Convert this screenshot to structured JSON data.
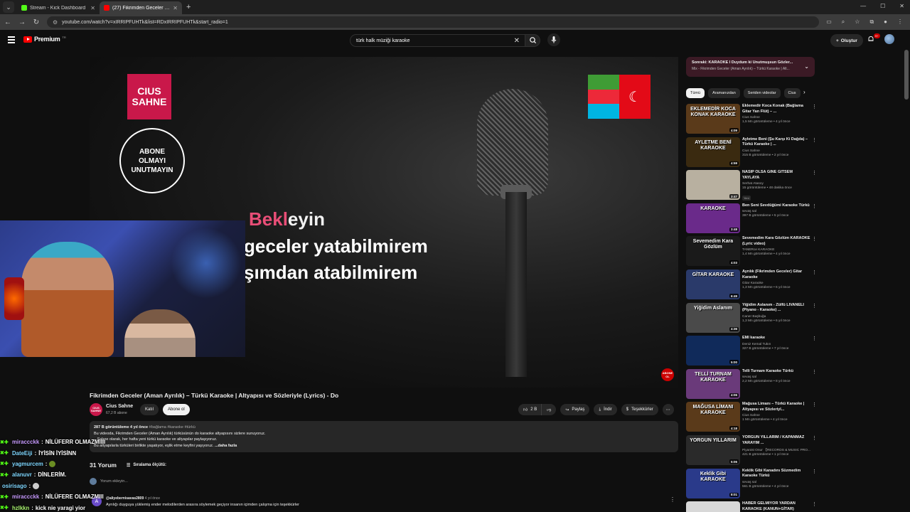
{
  "browser": {
    "tabs": [
      {
        "title": "Stream - Kick Dashboard",
        "active": false,
        "favicon_color": "#53fc18"
      },
      {
        "title": "(27) Fikrimden Geceler (Am...",
        "active": true,
        "favicon_color": "#ff0000"
      }
    ],
    "url": "youtube.com/watch?v=xIRRIPFUHTk&list=RDxIRRIPFUHTk&start_radio=1"
  },
  "youtube": {
    "logo_text": "Premium",
    "logo_sup": "TR",
    "search_query": "türk halk müziği karaoke",
    "create_label": "Oluştur",
    "notif_count": "9+"
  },
  "video": {
    "channel_logo_text": "CIUS SAHNE",
    "subscribe_circle_text": "ABONE OLMAYI UNUTMAYIN",
    "lyric_line1_highlight": "Bekl",
    "lyric_line1_rest": "eyin",
    "lyric_line2": "geceler yatabilmirem",
    "lyric_line3": "şımdan atabilmirem",
    "corner_badge": "ABONE OL",
    "title": "Fikrimden Geceler (Aman Ayrılık) – Türkü Karaoke | Altyapısı ve Sözleriyle (Lyrics) - Do",
    "channel_name": "Cius Sahne",
    "channel_subs": "67,2 B abone",
    "join_label": "Katıl",
    "subscribe_label": "Abone ol",
    "likes": "2 B",
    "share_label": "Paylaş",
    "download_label": "İndir",
    "thanks_label": "Teşekkürler",
    "desc_meta": "287 B görüntüleme  4 yıl önce",
    "desc_tags": "#bağlama #karaoke #türkü",
    "desc_line1": "Bu videoda, Fikrimden Geceler (Aman Ayrılık) türküsünün do karaoke altyapısını sizlere sunuyoruz.",
    "desc_line2": "...Sahne olarak, her hafta yeni türkü karaoke ve altyapılar paylaşıyoruz.",
    "desc_line3": "Bu altyapılarla türküleri birlikte yaşatıyor, eşlik etme keyfini yaşıyoruz. ",
    "desc_more": "...daha fazla"
  },
  "comments": {
    "count_label": "31 Yorum",
    "sort_label": "Sıralama ölçütü:",
    "add_placeholder": "Yorum ekleyin...",
    "first": {
      "avatar_letter": "A",
      "author": "@aliyebernisavas2809",
      "time": "4 yıl önce",
      "text": "Ayrılığı duyguya yüklemiş ender melodilerden arasıra söylemek geçiyor insanın içimden çalışma için teşekkürler"
    }
  },
  "chat": [
    {
      "nick": "miraccckk",
      "msg": "NİLÜFERR OLMAZMIIII"
    },
    {
      "nick": "DateEiji",
      "msg": "İYİSİN İYİSİNN"
    },
    {
      "nick": "yagmurcem",
      "msg": ""
    },
    {
      "nick": "alanuvr",
      "msg": "DİNLERİM."
    },
    {
      "nick": "osirisago",
      "msg": ""
    },
    {
      "nick": "miraccckk",
      "msg": "NİLÜFERE OLMAZMIII"
    },
    {
      "nick": "hzlkkn",
      "msg": "kick nie yaragi yior"
    }
  ],
  "sidebar": {
    "next_title": "Sonraki: KARAOKE I Duydum ki Unutmuşsun Gözler...",
    "next_sub": "Mix - Fikrimden Geceler (Aman Ayrılık) – Türkü Karaoke | Alt...",
    "chips": [
      "Tümü",
      "Aramanızdan",
      "Seriden videolar",
      "Cius"
    ],
    "items": [
      {
        "thumb": "EKLEMEDİR KOCA KONAK KARAOKE",
        "thumb_bg": "#5a3a1a",
        "dur": "4:09",
        "title": "Eklemedir Koca Konak (Bağlama Gitar Yan Flüt) – ...",
        "channel": "Cius Sahne",
        "views": "1,5 Mn görüntüleme • 4 yıl önce"
      },
      {
        "thumb": "AYLETME BENİ KARAOKE",
        "thumb_bg": "#3a2a10",
        "dur": "4:59",
        "title": "Ayletme Beni (Şu Karşı Ki Dağda) – Türkü Karaoke | ...",
        "channel": "Cius Sahne",
        "views": "315 B görüntüleme • 2 yıl önce"
      },
      {
        "thumb": "",
        "thumb_bg": "#b8b0a0",
        "dur": "3:47",
        "title": "NASİP OLSA GİNE GİTSEM YAYLAYA",
        "channel": "Serhat Atasoy",
        "views": "15 görüntüleme • 48 dakika önce",
        "tag": "Yeni"
      },
      {
        "thumb": "KARAOKE",
        "thumb_bg": "#6a2a8a",
        "dur": "3:48",
        "title": "Ben Seni Sevdüğümi Karaoke Türkü",
        "channel": "sevaş sal",
        "views": "397 B görüntüleme • 5 yıl önce"
      },
      {
        "thumb": "Sevemedim Kara Gözlüm",
        "thumb_bg": "#1a1a1a",
        "dur": "4:03",
        "title": "Sevemedim Kara Gözlüm KARAOKE (Lyric video)",
        "channel": "TANERce KARAOKE",
        "views": "1,4 Mn görüntüleme • 4 yıl önce"
      },
      {
        "thumb": "GİTAR KARAOKE",
        "thumb_bg": "#2a3a6a",
        "dur": "6:49",
        "title": "Ayrılık (Fikrimden Geceler) Gitar Karaoke",
        "channel": "Gitar Karaoke",
        "views": "1,3 Mn görüntüleme • 6 yıl önce"
      },
      {
        "thumb": "Yiğidim Aslanım",
        "thumb_bg": "#4a4a4a",
        "dur": "4:36",
        "title": "Yiğidim Aslanım - Zülfü LİVANELİ (Piyano - Karaoke) ...",
        "channel": "Caner Başbuğa",
        "views": "1,3 Mn görüntüleme • 6 yıl önce"
      },
      {
        "thumb": "",
        "thumb_bg": "#102a5a",
        "dur": "5:00",
        "title": "EMİ karaoke",
        "channel": "Deniz Kemal Tukın",
        "views": "327 B görüntüleme • 7 yıl önce"
      },
      {
        "thumb": "TELLİ TURNAM KARAOKE",
        "thumb_bg": "#6a3a7a",
        "dur": "4:06",
        "title": "Telli Turnam Karaoke Türkü",
        "channel": "sevaş sal",
        "views": "2,2 Mn görüntüleme • 8 yıl önce"
      },
      {
        "thumb": "MAĞUSA LİMANI KARAOKE",
        "thumb_bg": "#5a3a1a",
        "dur": "4:18",
        "title": "Mağusa Limanı – Türkü Karaoke | Altyapısı ve Sözleriyl...",
        "channel": "Cius Sahne",
        "views": "1 Mn görüntüleme • 4 yıl önce"
      },
      {
        "thumb": "YORGUN YILLARIM",
        "thumb_bg": "#2a2a2a",
        "dur": "5:06",
        "title": "YORGUN YILLARIM / KAPANMAZ YARAYIM ...",
        "channel": "Piyanist Onur 【RECORDS & MUSIC PRO...",
        "views": "421 B görüntüleme • 1 yıl önce"
      },
      {
        "thumb": "Keklik Gibi KARAOKE",
        "thumb_bg": "#2a3a8a",
        "dur": "8:01",
        "title": "Keklik Gibi Kanadını Süzmedim Karaoke Türkü",
        "channel": "sevaş sal",
        "views": "561 B görüntüleme • 4 yıl önce"
      },
      {
        "thumb": "",
        "thumb_bg": "#d8d8d8",
        "dur": "",
        "title": "HABER GELMİYOR YARDAN KARAOKE (KANUN+GİTAR)",
        "channel": "",
        "views": ""
      }
    ]
  },
  "colors": {
    "accent_red": "#ff0000",
    "kick_green": "#53fc18",
    "lyric_highlight": "#e94e77"
  }
}
